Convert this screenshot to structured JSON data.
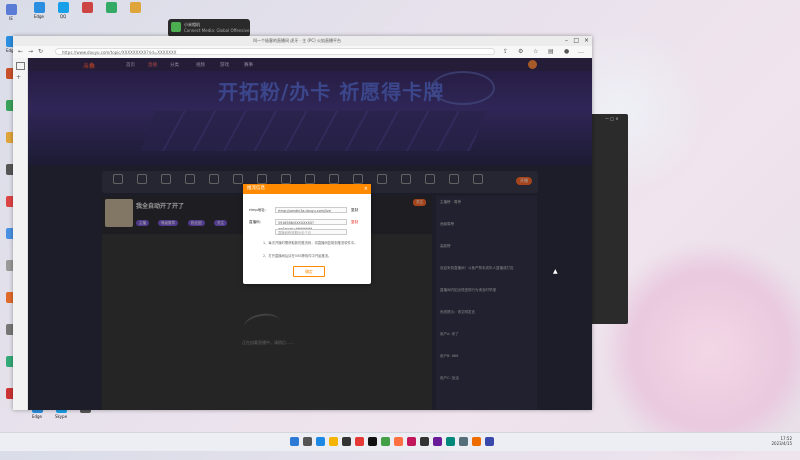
{
  "desktop": {
    "icons_left": [
      {
        "label": "IE",
        "color": "#5a7bd6"
      },
      {
        "label": "Edge",
        "color": "#2b8ee0"
      },
      {
        "label": "",
        "color": "#c94f2a"
      },
      {
        "label": "",
        "color": "#3aa15a"
      },
      {
        "label": "",
        "color": "#e0a53a"
      },
      {
        "label": "",
        "color": "#555"
      },
      {
        "label": "",
        "color": "#d44"
      },
      {
        "label": "",
        "color": "#4a90e2"
      },
      {
        "label": "",
        "color": "#999"
      },
      {
        "label": "",
        "color": "#e06b2a"
      },
      {
        "label": "",
        "color": "#777"
      },
      {
        "label": "",
        "color": "#3a7"
      },
      {
        "label": "",
        "color": "#c33"
      }
    ],
    "icons_top": [
      {
        "label": "Edge",
        "color": "#2b8ee0"
      },
      {
        "label": "QQ",
        "color": "#1aa0e8"
      },
      {
        "label": "",
        "color": "#c44"
      },
      {
        "label": "",
        "color": "#3a6"
      },
      {
        "label": "",
        "color": "#e0a53a"
      }
    ],
    "icons_bottom": [
      {
        "label": "Edge",
        "color": "#2b8ee0"
      },
      {
        "label": "Skype",
        "color": "#1aa0e8"
      },
      {
        "label": "",
        "color": "#555"
      }
    ],
    "notification": {
      "title": "小米相机",
      "body": "Connect Media: Global Offensive"
    }
  },
  "browser": {
    "title": "叫一个极客的直播间 虎牙 · 主 (PC) 火焰直播平台",
    "url": "https://www.douyu.com/topic/XXXXXXXXX?rid=XXXXXXX",
    "site": {
      "logo": "斗鱼",
      "nav": [
        "首页",
        "直播",
        "分类",
        "视频",
        "游戏",
        "赛事"
      ],
      "banner_text": "开拓粉/办卡 祈愿得卡牌",
      "toolbar_items": [
        "",
        "",
        "",
        "",
        "",
        "",
        "",
        "",
        "",
        "",
        "",
        "",
        "",
        "",
        "",
        "",
        "",
        ""
      ],
      "toolbar_button": "开播",
      "stream_title": "我全自动开了开了",
      "tags": [
        "主播",
        "等级徽章",
        "粉丝团",
        "关注"
      ],
      "loading_text": "正在加载直播中，请稍后……",
      "chat_lines": [
        "主播榜 · 周榜",
        "贡献周榜",
        "高能榜",
        "欢迎来到直播间！斗鱼严禁未成年人直播或打赏",
        "直播间内如出现违规行为请及时举报",
        "系统提示：请文明发言",
        "用户A: 来了",
        "用户B: 666",
        "用户C: 加油"
      ]
    },
    "modal": {
      "title": "推流信息",
      "close": "×",
      "row1_label": "rtmp地址：",
      "row1_value": "rtmp://sendtc3a.douyu.com/live",
      "row1_copy": "复制",
      "row2_label": "直播码：",
      "row2_value": "5916586rXXXXXXXX?wsSecret=**********",
      "row2_copy": "复制",
      "row3_value": "直播码有效期为半个月",
      "notes": [
        "1、每次开播时需获取新的推流码，将直播码复制到推流软件中。",
        "2、打开直播间后请在OBS等软件中开始推流。"
      ],
      "button": "确定"
    }
  },
  "taskbar": {
    "time": "17:52",
    "date": "2023/4/15",
    "icons": [
      "#2b7bd6",
      "#555",
      "#1e88e5",
      "#f4b400",
      "#333",
      "#e53935",
      "#111",
      "#43a047",
      "#ff7043",
      "#c2185b",
      "#333",
      "#6a1b9a",
      "#00897b",
      "#546e7a",
      "#ef6c00",
      "#3949ab"
    ]
  }
}
